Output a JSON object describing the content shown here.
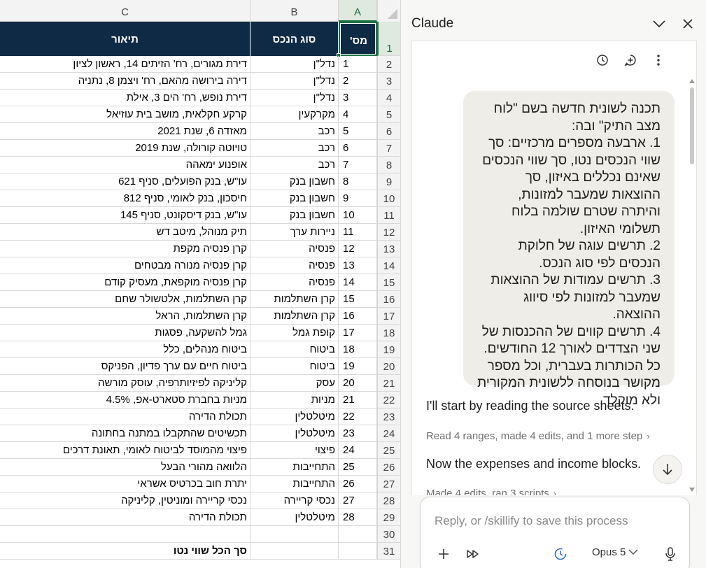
{
  "spreadsheet": {
    "columns": [
      "C",
      "B",
      "A"
    ],
    "selected_cell_row": "1",
    "header": {
      "c": "תיאור",
      "b": "סוג הנכס",
      "a": "מס'"
    },
    "rows": [
      {
        "n": "2",
        "a": "1",
        "b": "נדל\"ן",
        "c": "דירת מגורים, רח' הזיתים 14, ראשון לציון"
      },
      {
        "n": "3",
        "a": "2",
        "b": "נדל\"ן",
        "c": "דירה בירושה מהאם, רח' ויצמן 8, נתניה"
      },
      {
        "n": "4",
        "a": "3",
        "b": "נדל\"ן",
        "c": "דירת נופש, רח' הים 3, אילת"
      },
      {
        "n": "5",
        "a": "4",
        "b": "מקרקעין",
        "c": "קרקע חקלאית, מושב בית עוזיאל"
      },
      {
        "n": "6",
        "a": "5",
        "b": "רכב",
        "c": "מאזדה 6, שנת 2021"
      },
      {
        "n": "7",
        "a": "6",
        "b": "רכב",
        "c": "טויוטה קורולה, שנת 2019"
      },
      {
        "n": "8",
        "a": "7",
        "b": "רכב",
        "c": "אופנוע ימאהה"
      },
      {
        "n": "9",
        "a": "8",
        "b": "חשבון בנק",
        "c": "עו\"ש, בנק הפועלים, סניף 621"
      },
      {
        "n": "10",
        "a": "9",
        "b": "חשבון בנק",
        "c": "חיסכון, בנק לאומי, סניף 812"
      },
      {
        "n": "11",
        "a": "10",
        "b": "חשבון בנק",
        "c": "עו\"ש, בנק דיסקונט, סניף 145"
      },
      {
        "n": "12",
        "a": "11",
        "b": "ניירות ערך",
        "c": "תיק מנוהל, מיטב דש"
      },
      {
        "n": "13",
        "a": "12",
        "b": "פנסיה",
        "c": "קרן פנסיה מקפת"
      },
      {
        "n": "14",
        "a": "13",
        "b": "פנסיה",
        "c": "קרן פנסיה מנורה מבטחים"
      },
      {
        "n": "15",
        "a": "14",
        "b": "פנסיה",
        "c": "קרן פנסיה מוקפאת, מעסיק קודם"
      },
      {
        "n": "16",
        "a": "15",
        "b": "קרן השתלמות",
        "c": "קרן השתלמות, אלטשולר שחם"
      },
      {
        "n": "17",
        "a": "16",
        "b": "קרן השתלמות",
        "c": "קרן השתלמות, הראל"
      },
      {
        "n": "18",
        "a": "17",
        "b": "קופת גמל",
        "c": "גמל להשקעה, פסגות"
      },
      {
        "n": "19",
        "a": "18",
        "b": "ביטוח",
        "c": "ביטוח מנהלים, כלל"
      },
      {
        "n": "20",
        "a": "19",
        "b": "ביטוח",
        "c": "ביטוח חיים עם ערך פדיון, הפניקס"
      },
      {
        "n": "21",
        "a": "20",
        "b": "עסק",
        "c": "קליניקה לפיזיותרפיה, עוסק מורשה"
      },
      {
        "n": "22",
        "a": "21",
        "b": "מניות",
        "c": "מניות בחברת סטארט-אפ, 4.5%"
      },
      {
        "n": "23",
        "a": "22",
        "b": "מיטלטלין",
        "c": "תכולת הדירה"
      },
      {
        "n": "24",
        "a": "23",
        "b": "מיטלטלין",
        "c": "תכשיטים שהתקבלו במתנה בחתונה"
      },
      {
        "n": "25",
        "a": "24",
        "b": "פיצוי",
        "c": "פיצוי מהמוסד לביטוח לאומי, תאונת דרכים"
      },
      {
        "n": "26",
        "a": "25",
        "b": "התחייבות",
        "c": "הלוואה מהורי הבעל"
      },
      {
        "n": "27",
        "a": "26",
        "b": "התחייבות",
        "c": "יתרת חוב בכרטיס אשראי"
      },
      {
        "n": "28",
        "a": "27",
        "b": "נכסי קריירה",
        "c": "נכסי קריירה ומוניטין, קליניקה"
      },
      {
        "n": "29",
        "a": "28",
        "b": "מיטלטלין",
        "c": "תכולת הדירה"
      },
      {
        "n": "30",
        "a": "",
        "b": "",
        "c": ""
      },
      {
        "n": "31",
        "a": "",
        "b": "",
        "c": "סך הכל שווי נטו",
        "bold": true
      }
    ]
  },
  "panel": {
    "title": "Claude",
    "user_message": "תכנה לשונית חדשה בשם \"לוח מצב התיק\" ובה:\n1. ארבעה מספרים מרכזיים: סך שווי הנכסים נטו, סך שווי הנכסים שאינם נכללים באיזון, סך ההוצאות שמעבר למזונות, והיתרה שטרם שולמה בלוח תשלומי האיזון.\n2. תרשים עוגה של חלוקת הנכסים לפי סוג הנכס.\n3. תרשים עמודות של ההוצאות שמעבר למזונות לפי סיווג ההוצאה.\n4. תרשים קווים של ההכנסות של שני הצדדים לאורך 12 החודשים.\nכל הכותרות בעברית, וכל מספר מקושר בנוסחה ללשונית המקורית ולא מוקלד.",
    "assistant_1": "I'll start by reading the source sheets.",
    "step_1": "Read 4 ranges, made 4 edits, and 1 more step",
    "assistant_2": "Now the expenses and income blocks.",
    "step_2": "Made 4 edits, ran 3 scripts",
    "composer_placeholder": "Reply, or /skillify to save this process",
    "model_label": "Opus 5"
  },
  "colors": {
    "header_bg": "#0f2a44",
    "selection_green": "#1e7145",
    "timer_icon_blue": "#2f6fd6"
  }
}
